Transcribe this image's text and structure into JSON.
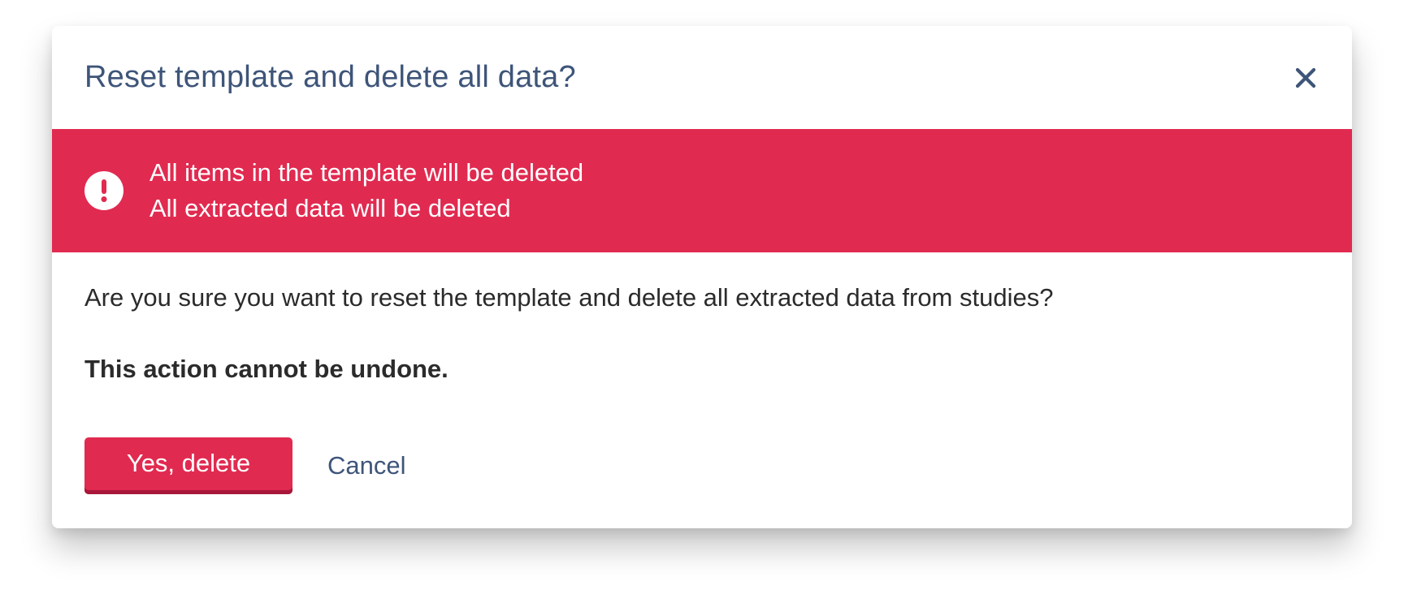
{
  "dialog": {
    "title": "Reset template and delete all data?",
    "close_icon": "close-icon",
    "banner": {
      "icon": "exclamation-circle-icon",
      "background_color": "#e12a50",
      "lines": [
        "All items in the template will be deleted",
        "All extracted data will be deleted"
      ]
    },
    "question": "Are you sure you want to reset the template and delete all extracted data from studies?",
    "warning": "This action cannot be undone.",
    "actions": {
      "confirm_label": "Yes, delete",
      "cancel_label": "Cancel"
    },
    "colors": {
      "title": "#3e5579",
      "danger": "#e12a50",
      "text": "#2b2b2b"
    }
  }
}
